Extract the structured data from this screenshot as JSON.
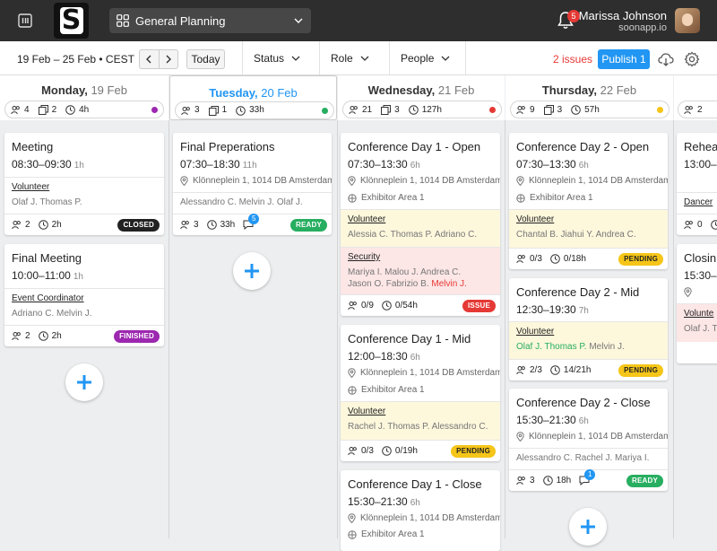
{
  "header": {
    "logo_letter": "S",
    "project": "General Planning",
    "notification_count": "5",
    "user_name": "Marissa Johnson",
    "user_org": "soonapp.io"
  },
  "toolbar": {
    "date_range": "19 Feb – 25 Feb • CEST",
    "today_label": "Today",
    "filters": [
      "Status",
      "Role",
      "People"
    ],
    "issues": "2 issues",
    "publish": "Publish 1"
  },
  "days": [
    {
      "name": "Monday,",
      "date": "19 Feb",
      "people": "4",
      "shifts": "2",
      "hours": "4h",
      "dot": "#9c27b0"
    },
    {
      "name": "Tuesday,",
      "date": "20 Feb",
      "people": "3",
      "shifts": "1",
      "hours": "33h",
      "dot": "#27ae60"
    },
    {
      "name": "Wednesday,",
      "date": "21 Feb",
      "people": "21",
      "shifts": "3",
      "hours": "127h",
      "dot": "#e53935"
    },
    {
      "name": "Thursday,",
      "date": "22 Feb",
      "people": "9",
      "shifts": "3",
      "hours": "57h",
      "dot": "#f5c518"
    },
    {
      "people": "2"
    }
  ],
  "cards": {
    "mon1": {
      "title": "Meeting",
      "time": "08:30–09:30",
      "dur": "1h",
      "role": "Volunteer",
      "people": "Olaf J. Thomas P.",
      "count": "2",
      "hours": "2h",
      "status": "CLOSED"
    },
    "mon2": {
      "title": "Final Meeting",
      "time": "10:00–11:00",
      "dur": "1h",
      "role": "Event Coordinator",
      "people": "Adriano C. Melvin J.",
      "count": "2",
      "hours": "2h",
      "status": "FINISHED"
    },
    "tue1": {
      "title": "Final Preperations",
      "time": "07:30–18:30",
      "dur": "11h",
      "loc": "Klönneplein 1, 1014 DB Amsterdam",
      "people": "Alessandro C. Melvin J. Olaf J.",
      "count": "3",
      "hours": "33h",
      "comments": "5",
      "status": "READY"
    },
    "wed1": {
      "title": "Conference Day 1 - Open",
      "time": "07:30–13:30",
      "dur": "6h",
      "loc": "Klönneplein 1, 1014 DB Amsterdam",
      "area": "Exhibitor Area 1",
      "role1": "Volunteer",
      "people1": "Alessia C. Thomas P. Adriano C.",
      "role2": "Security",
      "people2a": "Mariya I. Malou J. Andrea C.",
      "people2b": "Jason O. Fabrizio B.",
      "people2c": "Melvin J.",
      "count": "0/9",
      "hours": "0/54h",
      "status": "ISSUE"
    },
    "wed2": {
      "title": "Conference Day 1 - Mid",
      "time": "12:00–18:30",
      "dur": "6h",
      "loc": "Klönneplein 1, 1014 DB Amsterdam",
      "area": "Exhibitor Area 1",
      "role": "Volunteer",
      "people": "Rachel J. Thomas P. Alessandro C.",
      "count": "0/3",
      "hours": "0/19h",
      "status": "PENDING"
    },
    "wed3": {
      "title": "Conference Day 1 - Close",
      "time": "15:30–21:30",
      "dur": "6h",
      "loc": "Klönneplein 1, 1014 DB Amsterdam",
      "area": "Exhibitor Area 1"
    },
    "thu1": {
      "title": "Conference Day 2 - Open",
      "time": "07:30–13:30",
      "dur": "6h",
      "loc": "Klönneplein 1, 1014 DB Amsterdam",
      "area": "Exhibitor Area 1",
      "role": "Volunteer",
      "people": "Chantal B. Jiahui Y. Andrea C.",
      "count": "0/3",
      "hours": "0/18h",
      "status": "PENDING"
    },
    "thu2": {
      "title": "Conference Day 2 - Mid",
      "time": "12:30–19:30",
      "dur": "7h",
      "role": "Volunteer",
      "people_green": "Olaf J. Thomas P.",
      "people_rest": "Melvin J.",
      "count": "2/3",
      "hours": "14/21h",
      "status": "PENDING"
    },
    "thu3": {
      "title": "Conference Day 2 - Close",
      "time": "15:30–21:30",
      "dur": "6h",
      "loc": "Klönneplein 1, 1014 DB Amsterdam",
      "people": "Alessandro C. Rachel J. Mariya I.",
      "count": "3",
      "hours": "18h",
      "comments": "1",
      "status": "READY"
    },
    "fri1": {
      "title": "Rehear",
      "time": "13:00–1",
      "role": "Dancer",
      "count": "0"
    },
    "fri2": {
      "title": "Closin",
      "time": "15:30–",
      "role": "Volunte",
      "people": "Olaf J. T"
    }
  },
  "colors": {
    "accent": "#2196f3",
    "issue": "#e53935",
    "ready": "#27ae60",
    "pending": "#f5c518",
    "finished": "#9c27b0"
  }
}
